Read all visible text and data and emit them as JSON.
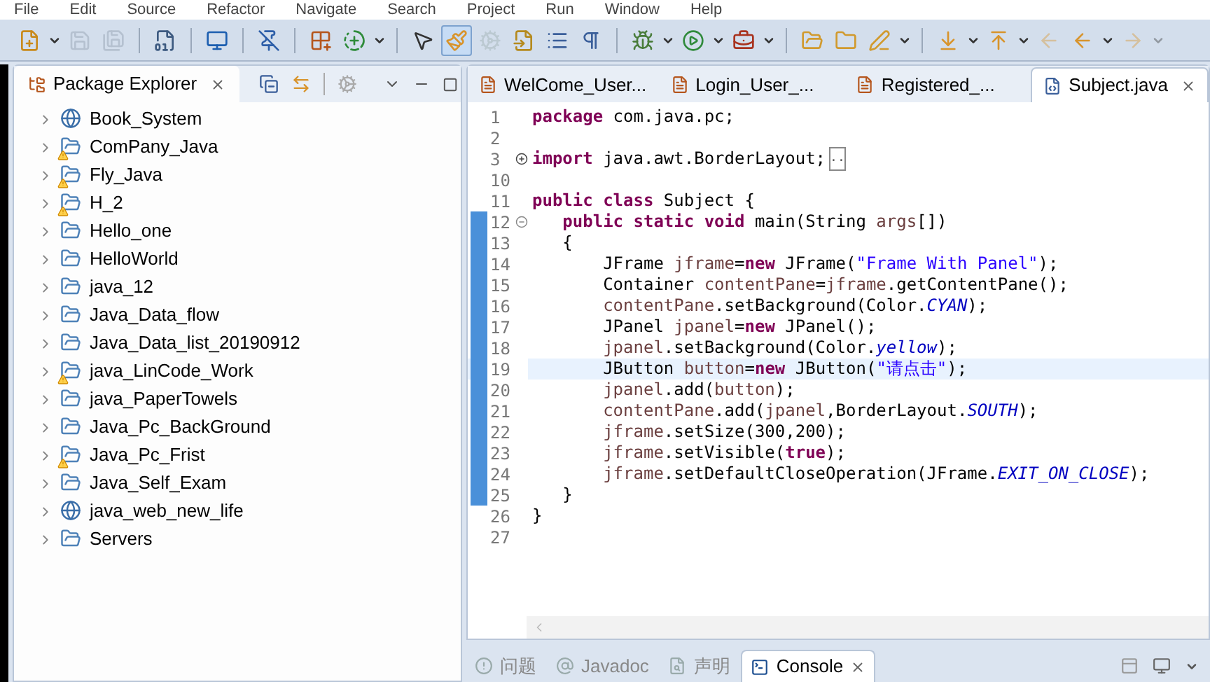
{
  "menu_bar": [
    "File",
    "Edit",
    "Source",
    "Refactor",
    "Navigate",
    "Search",
    "Project",
    "Run",
    "Window",
    "Help"
  ],
  "toolbar": [
    {
      "kind": "new-file",
      "dropdown": true,
      "disabled": false,
      "selected": false,
      "separator_after": false
    },
    {
      "kind": "save",
      "dropdown": false,
      "disabled": true,
      "selected": false,
      "separator_after": false
    },
    {
      "kind": "save-all",
      "dropdown": false,
      "disabled": true,
      "selected": false,
      "separator_after": true
    },
    {
      "kind": "binary",
      "dropdown": false,
      "disabled": false,
      "selected": false,
      "separator_after": true
    },
    {
      "kind": "monitor",
      "dropdown": false,
      "disabled": false,
      "selected": false,
      "separator_after": true
    },
    {
      "kind": "pin-off",
      "dropdown": false,
      "disabled": false,
      "selected": false,
      "separator_after": true
    },
    {
      "kind": "grid-plus",
      "dropdown": false,
      "disabled": false,
      "selected": false,
      "separator_after": false
    },
    {
      "kind": "class",
      "dropdown": true,
      "disabled": false,
      "selected": false,
      "separator_after": true
    },
    {
      "kind": "cursor-class",
      "dropdown": false,
      "disabled": false,
      "selected": false,
      "separator_after": false
    },
    {
      "kind": "brush",
      "dropdown": false,
      "disabled": false,
      "selected": true,
      "separator_after": false
    },
    {
      "kind": "gears",
      "dropdown": false,
      "disabled": true,
      "selected": false,
      "separator_after": false
    },
    {
      "kind": "doc-arrow",
      "dropdown": false,
      "disabled": false,
      "selected": false,
      "separator_after": false
    },
    {
      "kind": "list",
      "dropdown": false,
      "disabled": false,
      "selected": false,
      "separator_after": false
    },
    {
      "kind": "paragraph",
      "dropdown": false,
      "disabled": false,
      "selected": false,
      "separator_after": true
    },
    {
      "kind": "bug",
      "dropdown": true,
      "disabled": false,
      "selected": false,
      "separator_after": false
    },
    {
      "kind": "run",
      "dropdown": true,
      "disabled": false,
      "selected": false,
      "separator_after": false
    },
    {
      "kind": "run-tool",
      "dropdown": true,
      "disabled": false,
      "selected": false,
      "separator_after": true
    },
    {
      "kind": "folder-open",
      "dropdown": false,
      "disabled": false,
      "selected": false,
      "separator_after": false
    },
    {
      "kind": "folder",
      "dropdown": false,
      "disabled": false,
      "selected": false,
      "separator_after": false
    },
    {
      "kind": "pen",
      "dropdown": true,
      "disabled": false,
      "selected": false,
      "separator_after": true
    },
    {
      "kind": "next-annotation",
      "dropdown": true,
      "disabled": false,
      "selected": false,
      "separator_after": false
    },
    {
      "kind": "prev-annotation",
      "dropdown": true,
      "disabled": false,
      "selected": false,
      "separator_after": false
    },
    {
      "kind": "back",
      "dropdown": false,
      "disabled": true,
      "selected": false,
      "separator_after": false
    },
    {
      "kind": "back",
      "dropdown": true,
      "disabled": false,
      "selected": false,
      "separator_after": false
    },
    {
      "kind": "forward",
      "dropdown": true,
      "disabled": true,
      "selected": false,
      "separator_after": false
    }
  ],
  "package_explorer": {
    "title": "Package Explorer",
    "projects": [
      {
        "name": "Book_System",
        "kind": "web",
        "warning": false
      },
      {
        "name": "ComPany_Java",
        "kind": "project",
        "warning": true
      },
      {
        "name": "Fly_Java",
        "kind": "project",
        "warning": true
      },
      {
        "name": "H_2",
        "kind": "project",
        "warning": true
      },
      {
        "name": "Hello_one",
        "kind": "project",
        "warning": false
      },
      {
        "name": "HelloWorld",
        "kind": "project",
        "warning": false
      },
      {
        "name": "java_12",
        "kind": "project",
        "warning": false
      },
      {
        "name": "Java_Data_flow",
        "kind": "project",
        "warning": false
      },
      {
        "name": "Java_Data_list_20190912",
        "kind": "project",
        "warning": false
      },
      {
        "name": "java_LinCode_Work",
        "kind": "project",
        "warning": true
      },
      {
        "name": "java_PaperTowels",
        "kind": "project",
        "warning": false
      },
      {
        "name": "Java_Pc_BackGround",
        "kind": "project",
        "warning": false
      },
      {
        "name": "Java_Pc_Frist",
        "kind": "project",
        "warning": true
      },
      {
        "name": "Java_Self_Exam",
        "kind": "project",
        "warning": false
      },
      {
        "name": "java_web_new_life",
        "kind": "web",
        "warning": false
      },
      {
        "name": "Servers",
        "kind": "project",
        "warning": false
      }
    ]
  },
  "editor_tabs": [
    {
      "label": "WelCome_User...",
      "selected": false
    },
    {
      "label": "Login_User_...",
      "selected": false
    },
    {
      "label": "Registered_...",
      "selected": false
    },
    {
      "label": "Subject.java",
      "selected": true
    }
  ],
  "code_lines": [
    {
      "number": "1",
      "changed": false,
      "current": false,
      "tokens": [
        {
          "text": "package",
          "kind": "keyword"
        },
        {
          "text": " com.java.pc;",
          "kind": "plain"
        }
      ]
    },
    {
      "number": "2",
      "changed": false,
      "current": false
    },
    {
      "number": "3",
      "changed": false,
      "current": false,
      "collapsed": true,
      "tokens": [
        {
          "text": "import",
          "kind": "keyword"
        },
        {
          "text": " java.awt.BorderLayout;",
          "kind": "plain"
        },
        {
          "text": "..",
          "kind": "folded"
        }
      ]
    },
    {
      "number": "10",
      "changed": false,
      "current": false
    },
    {
      "number": "11",
      "changed": false,
      "current": false,
      "tokens": [
        {
          "text": "public class",
          "kind": "keyword"
        },
        {
          "text": " Subject {",
          "kind": "plain"
        }
      ]
    },
    {
      "number": "12",
      "changed": true,
      "current": false,
      "collapsed": false,
      "tokens": [
        {
          "text": "   public static void",
          "kind": "keyword"
        },
        {
          "text": " main(String ",
          "kind": "plain"
        },
        {
          "text": "args",
          "kind": "local"
        },
        {
          "text": "[])",
          "kind": "plain"
        }
      ]
    },
    {
      "number": "13",
      "changed": true,
      "current": false,
      "tokens": [
        {
          "text": "   {",
          "kind": "plain"
        }
      ]
    },
    {
      "number": "14",
      "changed": true,
      "current": false,
      "tokens": [
        {
          "text": "       JFrame ",
          "kind": "plain"
        },
        {
          "text": "jframe",
          "kind": "local"
        },
        {
          "text": "=",
          "kind": "plain"
        },
        {
          "text": "new",
          "kind": "keyword"
        },
        {
          "text": " JFrame(",
          "kind": "plain"
        },
        {
          "text": "\"Frame With Panel\"",
          "kind": "string"
        },
        {
          "text": ");",
          "kind": "plain"
        }
      ]
    },
    {
      "number": "15",
      "changed": true,
      "current": false,
      "tokens": [
        {
          "text": "       Container ",
          "kind": "plain"
        },
        {
          "text": "contentPane",
          "kind": "local"
        },
        {
          "text": "=",
          "kind": "plain"
        },
        {
          "text": "jframe",
          "kind": "local"
        },
        {
          "text": ".getContentPane();",
          "kind": "plain"
        }
      ]
    },
    {
      "number": "16",
      "changed": true,
      "current": false,
      "tokens": [
        {
          "text": "       contentPane",
          "kind": "local"
        },
        {
          "text": ".setBackground(Color.",
          "kind": "plain"
        },
        {
          "text": "CYAN",
          "kind": "field"
        },
        {
          "text": ");",
          "kind": "plain"
        }
      ]
    },
    {
      "number": "17",
      "changed": true,
      "current": false,
      "tokens": [
        {
          "text": "       JPanel ",
          "kind": "plain"
        },
        {
          "text": "jpanel",
          "kind": "local"
        },
        {
          "text": "=",
          "kind": "plain"
        },
        {
          "text": "new",
          "kind": "keyword"
        },
        {
          "text": " JPanel();",
          "kind": "plain"
        }
      ]
    },
    {
      "number": "18",
      "changed": true,
      "current": false,
      "tokens": [
        {
          "text": "       jpanel",
          "kind": "local"
        },
        {
          "text": ".setBackground(Color.",
          "kind": "plain"
        },
        {
          "text": "yellow",
          "kind": "field"
        },
        {
          "text": ");",
          "kind": "plain"
        }
      ]
    },
    {
      "number": "19",
      "changed": true,
      "current": true,
      "tokens": [
        {
          "text": "       JButton ",
          "kind": "plain"
        },
        {
          "text": "button",
          "kind": "local"
        },
        {
          "text": "=",
          "kind": "plain"
        },
        {
          "text": "new",
          "kind": "keyword"
        },
        {
          "text": " JButton(",
          "kind": "plain"
        },
        {
          "text": "\"请点击\"",
          "kind": "string"
        },
        {
          "text": ");",
          "kind": "plain"
        }
      ]
    },
    {
      "number": "20",
      "changed": true,
      "current": false,
      "tokens": [
        {
          "text": "       jpanel",
          "kind": "local"
        },
        {
          "text": ".add(",
          "kind": "plain"
        },
        {
          "text": "button",
          "kind": "local"
        },
        {
          "text": ");",
          "kind": "plain"
        }
      ]
    },
    {
      "number": "21",
      "changed": true,
      "current": false,
      "tokens": [
        {
          "text": "       contentPane",
          "kind": "local"
        },
        {
          "text": ".add(",
          "kind": "plain"
        },
        {
          "text": "jpanel",
          "kind": "local"
        },
        {
          "text": ",BorderLayout.",
          "kind": "plain"
        },
        {
          "text": "SOUTH",
          "kind": "field"
        },
        {
          "text": ");",
          "kind": "plain"
        }
      ]
    },
    {
      "number": "22",
      "changed": true,
      "current": false,
      "tokens": [
        {
          "text": "       jframe",
          "kind": "local"
        },
        {
          "text": ".setSize(300,200);",
          "kind": "plain"
        }
      ]
    },
    {
      "number": "23",
      "changed": true,
      "current": false,
      "tokens": [
        {
          "text": "       jframe",
          "kind": "local"
        },
        {
          "text": ".setVisible(",
          "kind": "plain"
        },
        {
          "text": "true",
          "kind": "keyword"
        },
        {
          "text": ");",
          "kind": "plain"
        }
      ]
    },
    {
      "number": "24",
      "changed": true,
      "current": false,
      "tokens": [
        {
          "text": "       jframe",
          "kind": "local"
        },
        {
          "text": ".setDefaultCloseOperation(JFrame.",
          "kind": "plain"
        },
        {
          "text": "EXIT_ON_CLOSE",
          "kind": "field"
        },
        {
          "text": ");",
          "kind": "plain"
        }
      ]
    },
    {
      "number": "25",
      "changed": true,
      "current": false,
      "tokens": [
        {
          "text": "   }",
          "kind": "plain"
        }
      ]
    },
    {
      "number": "26",
      "changed": false,
      "current": false,
      "tokens": [
        {
          "text": "}",
          "kind": "plain"
        }
      ]
    },
    {
      "number": "27",
      "changed": false,
      "current": false
    }
  ],
  "bottom_tabs": [
    {
      "label": "问题",
      "kind": "problems",
      "selected": false
    },
    {
      "label": "Javadoc",
      "kind": "javadoc",
      "selected": false
    },
    {
      "label": "声明",
      "kind": "declaration",
      "selected": false
    },
    {
      "label": "Console",
      "kind": "console",
      "selected": true
    }
  ]
}
